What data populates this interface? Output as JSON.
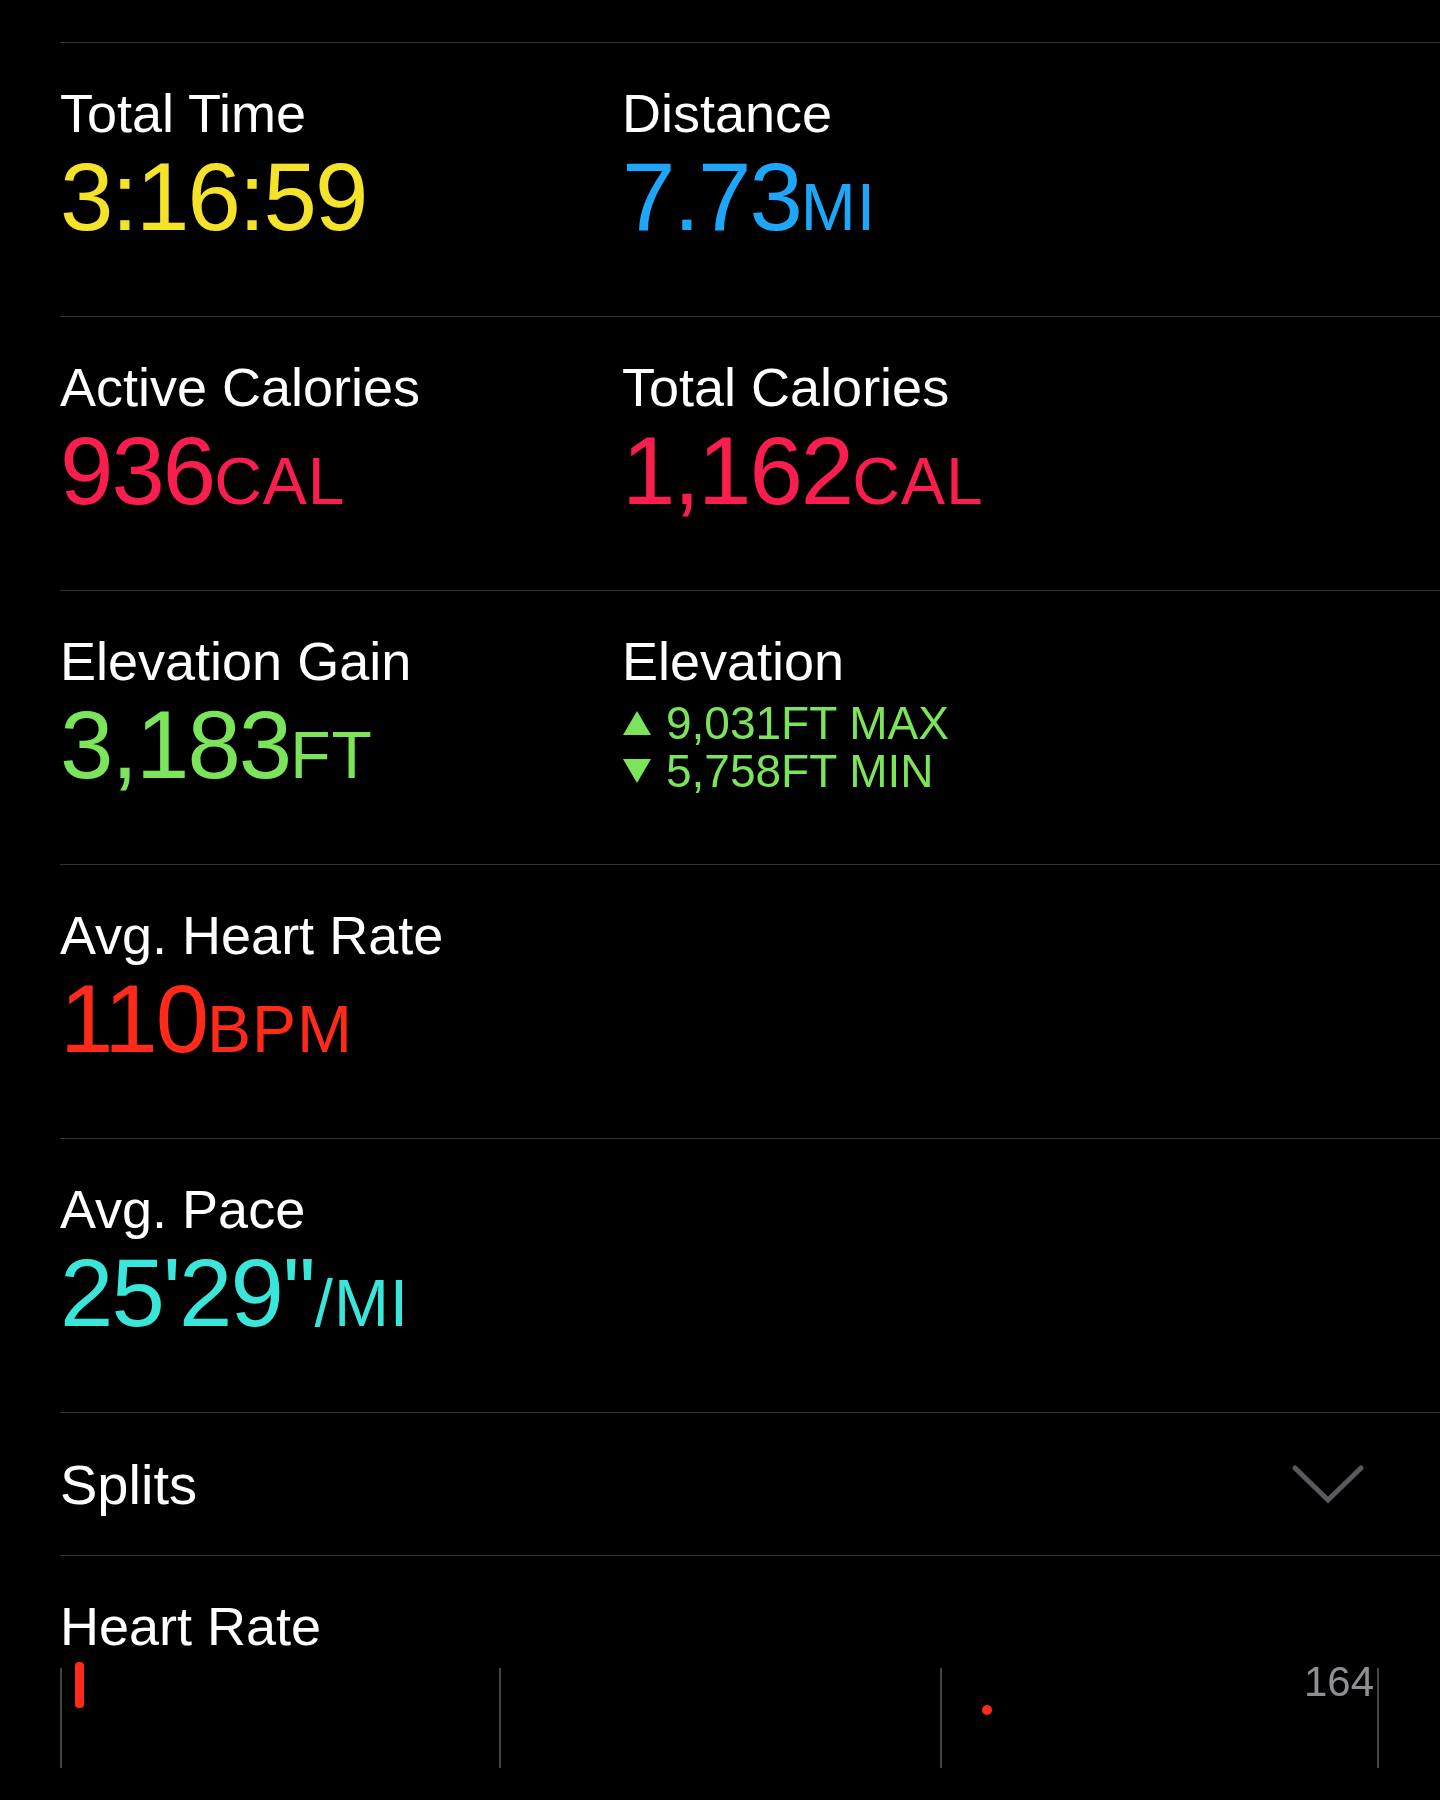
{
  "metric_rows": [
    {
      "items": [
        {
          "label": "Total Time",
          "kind": "single",
          "color": "#f4e22b",
          "value": "3:16:59"
        },
        {
          "label": "Distance",
          "kind": "single",
          "color": "#1ea6fa",
          "value": "7.73",
          "unit": "MI"
        }
      ]
    },
    {
      "items": [
        {
          "label": "Active Calories",
          "kind": "single",
          "color": "#fa1e4e",
          "value": "936",
          "unit": "CAL"
        },
        {
          "label": "Total Calories",
          "kind": "single",
          "color": "#fa1e4e",
          "value": "1,162",
          "unit": "CAL"
        }
      ]
    },
    {
      "items": [
        {
          "label": "Elevation Gain",
          "kind": "single",
          "color": "#7be45a",
          "value": "3,183",
          "unit": "FT"
        },
        {
          "label": "Elevation",
          "kind": "range",
          "color": "#7be45a",
          "lines": [
            {
              "kind": "up",
              "text": "9,031FT MAX"
            },
            {
              "kind": "down",
              "text": "5,758FT MIN"
            }
          ]
        }
      ]
    },
    {
      "items": [
        {
          "label": "Avg. Heart Rate",
          "kind": "single",
          "color": "#ff2a1a",
          "value": "110",
          "unit": "BPM"
        }
      ]
    },
    {
      "items": [
        {
          "label": "Avg. Pace",
          "kind": "single",
          "color": "#3ae6da",
          "value": "25'29''",
          "unit": "/MI"
        }
      ]
    }
  ],
  "splits": {
    "label": "Splits",
    "expanded": false
  },
  "heart_rate": {
    "title": "Heart Rate",
    "axis_label": "164"
  }
}
